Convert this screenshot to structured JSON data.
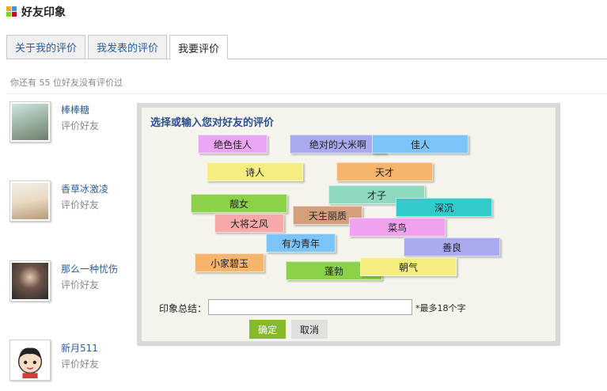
{
  "header": {
    "title": "好友印象",
    "icon": "friends-impression-icon"
  },
  "tabs": [
    {
      "label": "关于我的评价",
      "active": false
    },
    {
      "label": "我发表的评价",
      "active": false
    },
    {
      "label": "我要评价",
      "active": true
    }
  ],
  "pending_text": "你还有  55 位好友没有评价过",
  "friends": [
    {
      "name": "棒棒糖",
      "action": "评价好友"
    },
    {
      "name": "香草冰激凌",
      "action": "评价好友"
    },
    {
      "name": "那么一种忧伤",
      "action": "评价好友"
    },
    {
      "name": "新月511",
      "action": "评价好友"
    }
  ],
  "dialog": {
    "title": "选择或输入您对好友的评价",
    "tags": [
      {
        "label": "绝色佳人",
        "color": "#eaa6f2"
      },
      {
        "label": "佳人",
        "color": "#7cc4f8"
      },
      {
        "label": "绝对的大米啊",
        "color": "#a9aaf0"
      },
      {
        "label": "诗人",
        "color": "#f4ee80"
      },
      {
        "label": "天才",
        "color": "#f7b46c"
      },
      {
        "label": "才子",
        "color": "#8fd9bf"
      },
      {
        "label": "靓女",
        "color": "#8bd246"
      },
      {
        "label": "深沉",
        "color": "#30cccc"
      },
      {
        "label": "大将之风",
        "color": "#f7a8a8"
      },
      {
        "label": "天生丽质",
        "color": "#d4a07c"
      },
      {
        "label": "菜鸟",
        "color": "#f0a2ef"
      },
      {
        "label": "有为青年",
        "color": "#7cc4f8"
      },
      {
        "label": "善良",
        "color": "#a9aaf0"
      },
      {
        "label": "小家碧玉",
        "color": "#f7b46c"
      },
      {
        "label": "蓬勃",
        "color": "#8bd246"
      },
      {
        "label": "朝气",
        "color": "#f4ee80"
      }
    ],
    "summary_label": "印象总结：",
    "summary_value": "",
    "summary_hint": "*最多18个字",
    "ok_label": "确定",
    "cancel_label": "取消"
  }
}
